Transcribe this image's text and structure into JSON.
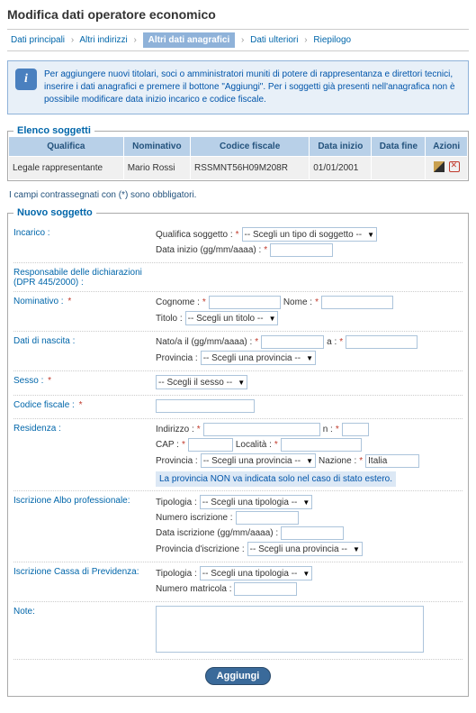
{
  "page_title": "Modifica dati operatore economico",
  "breadcrumb": {
    "items": [
      "Dati principali",
      "Altri indirizzi",
      "Altri dati anagrafici",
      "Dati ulteriori",
      "Riepilogo"
    ],
    "active_index": 2
  },
  "info_text": "Per aggiungere nuovi titolari, soci o amministratori muniti di potere di rappresentanza e direttori tecnici, inserire i dati anagrafici e premere il bottone \"Aggiungi\". Per i soggetti già presenti nell'anagrafica non è possibile modificare data inizio incarico e codice fiscale.",
  "subjects": {
    "legend": "Elenco soggetti",
    "headers": [
      "Qualifica",
      "Nominativo",
      "Codice fiscale",
      "Data inizio",
      "Data fine",
      "Azioni"
    ],
    "rows": [
      {
        "qualifica": "Legale rappresentante",
        "nominativo": "Mario Rossi",
        "cf": "RSSMNT56H09M208R",
        "inizio": "01/01/2001",
        "fine": ""
      }
    ]
  },
  "required_note": "I campi contrassegnati con (*) sono obbligatori.",
  "form": {
    "legend": "Nuovo soggetto",
    "incarico": {
      "label": "Incarico :",
      "qualifica_label": "Qualifica soggetto :",
      "qualifica_value": "-- Scegli un tipo di soggetto --",
      "data_inizio_label": "Data inizio (gg/mm/aaaa) :",
      "data_inizio_value": ""
    },
    "responsabile": {
      "label": "Responsabile delle dichiarazioni (DPR 445/2000) :"
    },
    "nominativo": {
      "label": "Nominativo :",
      "cognome_label": "Cognome :",
      "cognome_value": "",
      "nome_label": "Nome :",
      "nome_value": "",
      "titolo_label": "Titolo :",
      "titolo_value": "-- Scegli un titolo --"
    },
    "nascita": {
      "label": "Dati di nascita :",
      "natoil_label": "Nato/a il (gg/mm/aaaa) :",
      "natoil_value": "",
      "a_label": "a :",
      "a_value": "",
      "provincia_label": "Provincia :",
      "provincia_value": "-- Scegli una provincia --"
    },
    "sesso": {
      "label": "Sesso :",
      "value": "-- Scegli il sesso --"
    },
    "cf": {
      "label": "Codice fiscale :",
      "value": ""
    },
    "residenza": {
      "label": "Residenza :",
      "indirizzo_label": "Indirizzo :",
      "indirizzo_value": "",
      "n_label": "n :",
      "n_value": "",
      "cap_label": "CAP :",
      "cap_value": "",
      "localita_label": "Località :",
      "localita_value": "",
      "provincia_label": "Provincia :",
      "provincia_value": "-- Scegli una provincia --",
      "nazione_label": "Nazione :",
      "nazione_value": "Italia",
      "hint": "La provincia NON va indicata solo nel caso di stato estero."
    },
    "albo": {
      "label": "Iscrizione Albo professionale:",
      "tipologia_label": "Tipologia :",
      "tipologia_value": "-- Scegli una tipologia --",
      "numero_label": "Numero iscrizione :",
      "numero_value": "",
      "data_label": "Data iscrizione (gg/mm/aaaa) :",
      "data_value": "",
      "prov_label": "Provincia d'iscrizione :",
      "prov_value": "-- Scegli una provincia --"
    },
    "cassa": {
      "label": "Iscrizione Cassa di Previdenza:",
      "tipologia_label": "Tipologia :",
      "tipologia_value": "-- Scegli una tipologia --",
      "matricola_label": "Numero matricola :",
      "matricola_value": ""
    },
    "note": {
      "label": "Note:",
      "value": ""
    },
    "submit": "Aggiungi"
  }
}
